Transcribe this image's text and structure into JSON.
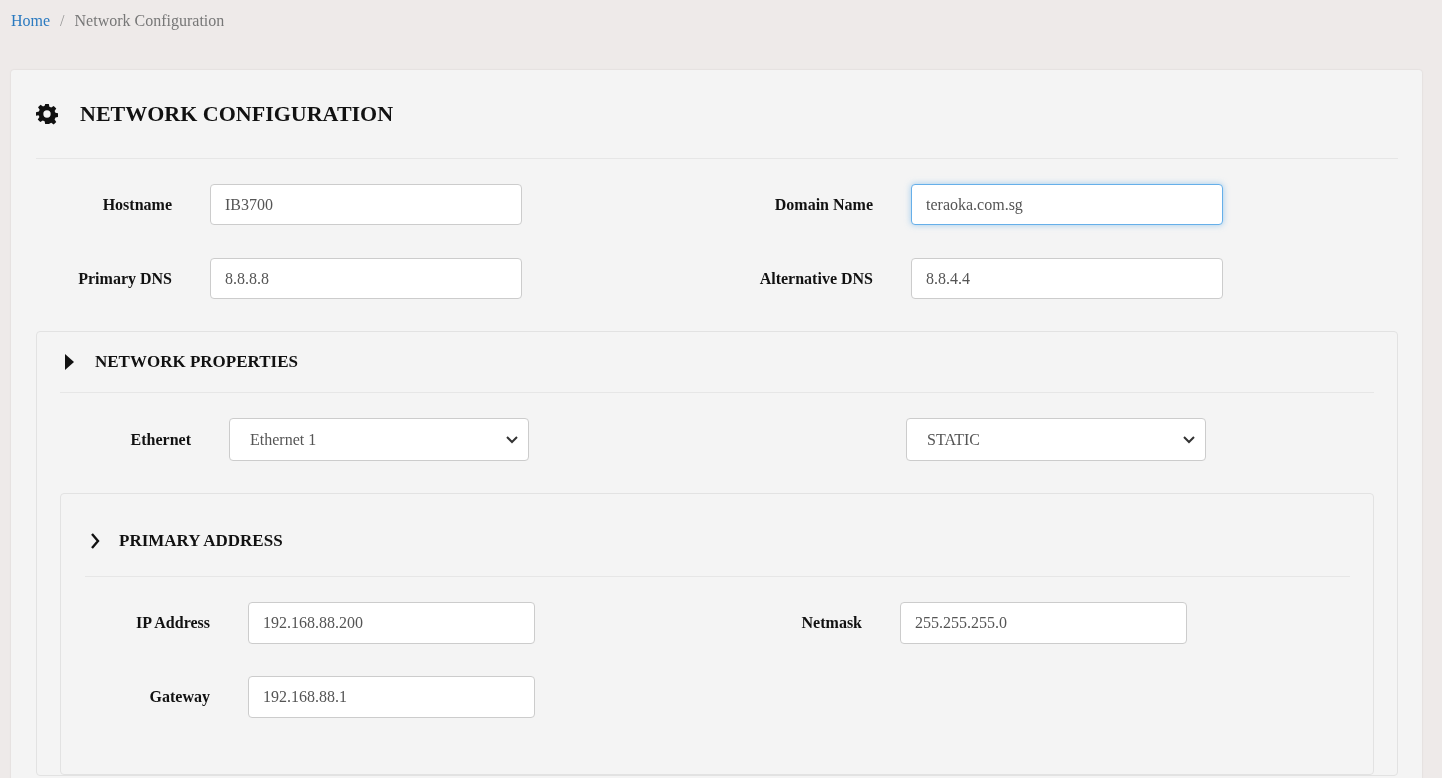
{
  "breadcrumb": [
    {
      "label": "Home",
      "kind": "link"
    },
    {
      "label": "Network Configuration",
      "kind": "current"
    }
  ],
  "breadcrumb_separator": "/",
  "title": "NETWORK CONFIGURATION",
  "fields": [
    {
      "label": "Hostname",
      "value": "IB3700",
      "focused": false
    },
    {
      "label": "Domain Name",
      "value": "teraoka.com.sg",
      "focused": true
    },
    {
      "label": "Primary DNS",
      "value": "8.8.8.8",
      "focused": false
    },
    {
      "label": "Alternative DNS",
      "value": "8.8.4.4",
      "focused": false
    }
  ],
  "network_properties": {
    "title": "NETWORK PROPERTIES",
    "ethernet_label": "Ethernet",
    "ethernet_select": "Ethernet 1",
    "mode_select": "STATIC",
    "primary_address": {
      "title": "PRIMARY ADDRESS",
      "fields": [
        {
          "label": "IP Address",
          "value": "192.168.88.200"
        },
        {
          "label": "Netmask",
          "value": "255.255.255.0"
        },
        {
          "label": "Gateway",
          "value": "192.168.88.1"
        }
      ]
    }
  }
}
